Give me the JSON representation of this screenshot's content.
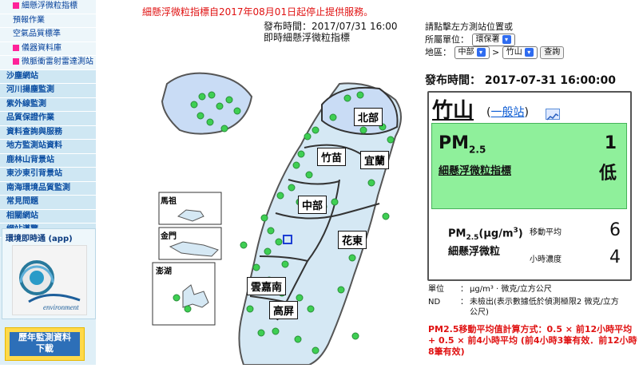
{
  "sidebar": {
    "items": [
      {
        "label": "細懸浮微粒指標",
        "type": "sub",
        "icon": "square-icon"
      },
      {
        "label": "預報作業",
        "type": "sub",
        "icon": ""
      },
      {
        "label": "空氣品質標準",
        "type": "sub",
        "icon": ""
      },
      {
        "label": "儀器資料庫",
        "type": "sub",
        "icon": "square-icon"
      },
      {
        "label": "微脈衝雷射雷達測站",
        "type": "sub",
        "icon": "square-icon"
      },
      {
        "label": "沙塵網站",
        "type": "main",
        "icon": ""
      },
      {
        "label": "河川揚塵監測",
        "type": "main",
        "icon": ""
      },
      {
        "label": "紫外線監測",
        "type": "main",
        "icon": ""
      },
      {
        "label": "品質保證作業",
        "type": "main",
        "icon": ""
      },
      {
        "label": "資料查詢與服務",
        "type": "main",
        "icon": ""
      },
      {
        "label": "地方監測站資料",
        "type": "main",
        "icon": ""
      },
      {
        "label": "鹿林山背景站",
        "type": "main",
        "icon": ""
      },
      {
        "label": "東沙東引背景站",
        "type": "main",
        "icon": ""
      },
      {
        "label": "南海環境品質監測",
        "type": "main",
        "icon": ""
      },
      {
        "label": "常見問題",
        "type": "main",
        "icon": ""
      },
      {
        "label": "相關網站",
        "type": "main",
        "icon": ""
      },
      {
        "label": "網站導覽",
        "type": "main",
        "icon": ""
      }
    ],
    "app_title": "環境即時通 (app)",
    "app_logo_text": "environment",
    "history_title": "歷年監測資料",
    "history_sub": "下載"
  },
  "notice": "細懸浮微粒指標自2017年08月01日起停止提供服務。",
  "map_meta": {
    "publish_line": "發布時間：2017/07/31 16:00",
    "caption": "即時細懸浮微粒指標"
  },
  "regions": {
    "north": "北部",
    "zhumiao": "竹苗",
    "yilan": "宜蘭",
    "central": "中部",
    "huadong": "花東",
    "yunjianan": "雲嘉南",
    "gaoping": "高屏",
    "mazu": "馬祖",
    "jinmen": "金門",
    "penghu": "澎湖"
  },
  "controls": {
    "hint": "請點擊左方測站位置或",
    "agency_label": "所屬單位：",
    "agency_value": "環保署",
    "area_label": "地區：",
    "area_value": "中部",
    "sep": ">",
    "station_value": "竹山",
    "query_button": "查詢"
  },
  "publish_time": "發布時間： 2017-07-31 16:00:00",
  "station": {
    "name": "竹山",
    "type_open": "(",
    "type": "一般站",
    "type_close": ")",
    "pm_label": "PM",
    "pm_sub": "2.5",
    "pm_value": "1",
    "pm_name": "細懸浮微粒指標",
    "pm_level": "低",
    "units_title_a": "PM",
    "units_title_sub": "2.5",
    "units_title_b": "(μg/m",
    "units_title_sup": "3",
    "units_title_c": ")",
    "units_sub": "細懸浮微粒",
    "ma_label": "移動平均",
    "ma_value": "6",
    "hr_label": "小時濃度",
    "hr_value": "4"
  },
  "notes": {
    "unit_k": "單位",
    "unit_v": "μg/m³ · 微克/立方公尺",
    "nd_k": "ND",
    "nd_v": "未檢出(表示數據低於偵測極限2 微克/立方公尺)"
  },
  "formula": "PM2.5移動平均值計算方式：0.5 × 前12小時平均 + 0.5 × 前4小時平均 (前4小時3筆有效．前12小時8筆有效)",
  "colors": {
    "accent": "#e01212",
    "good": "#8ff09b",
    "link": "#0b5bd3",
    "map_land": "#d5e8f4"
  }
}
